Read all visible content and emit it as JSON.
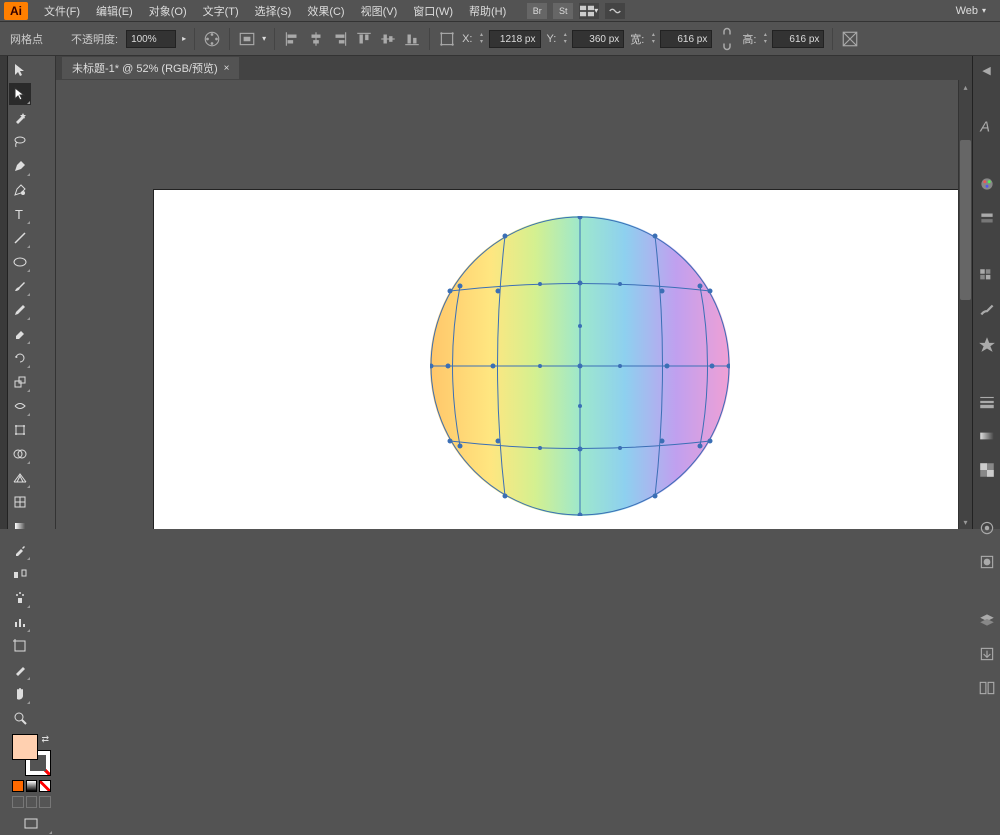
{
  "app": {
    "abbr": "Ai"
  },
  "menu": {
    "file": "文件(F)",
    "edit": "编辑(E)",
    "object": "对象(O)",
    "type": "文字(T)",
    "select": "选择(S)",
    "effect": "效果(C)",
    "view": "视图(V)",
    "window": "窗口(W)",
    "help": "帮助(H)",
    "bridge": "Br",
    "stock": "St",
    "workspace": "Web"
  },
  "options": {
    "object_label": "网格点",
    "opacity_label": "不透明度:",
    "opacity_value": "100%",
    "x_label": "X:",
    "x_value": "1218 px",
    "y_label": "Y:",
    "y_value": "360 px",
    "w_label": "宽:",
    "w_value": "616 px",
    "h_label": "高:",
    "h_value": "616 px"
  },
  "doc": {
    "tab_title": "未标题-1* @ 52% (RGB/预览)",
    "close": "×"
  },
  "colors": {
    "fill": "#ffd0b0",
    "accent": "#ff7f00",
    "mesh_line": "#3b6fb5"
  }
}
